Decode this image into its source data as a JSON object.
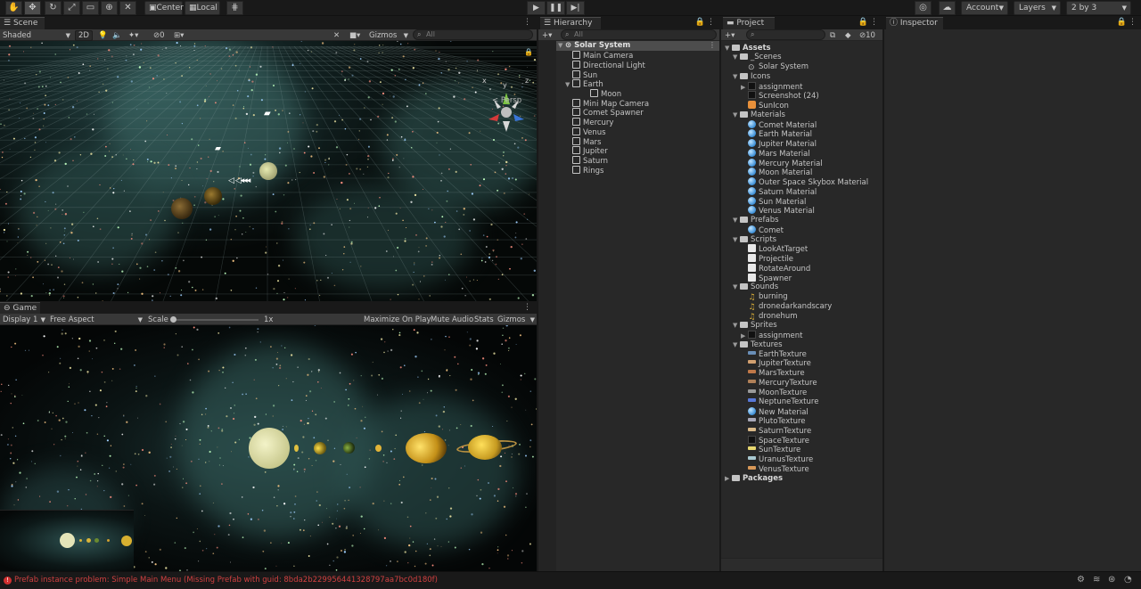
{
  "toolbar": {
    "pivot": "Center",
    "space": "Local",
    "account": "Account",
    "layers": "Layers",
    "layout": "2 by 3"
  },
  "scene": {
    "tab": "Scene",
    "shading": "Shaded",
    "mode_2d": "2D",
    "hidden_count": "0",
    "gizmos": "Gizmos",
    "search_placeholder": "All",
    "persp": "< Persp",
    "axis_x": "x",
    "axis_y": "y",
    "axis_z": "z"
  },
  "game": {
    "tab": "Game",
    "display": "Display 1",
    "aspect": "Free Aspect",
    "scale_label": "Scale",
    "scale_value": "1x",
    "maximize": "Maximize On Play",
    "mute": "Mute Audio",
    "stats": "Stats",
    "gizmos": "Gizmos"
  },
  "hierarchy": {
    "tab": "Hierarchy",
    "search_placeholder": "All",
    "root": "Solar System",
    "items": [
      {
        "label": "Main Camera",
        "depth": 1
      },
      {
        "label": "Directional Light",
        "depth": 1
      },
      {
        "label": "Sun",
        "depth": 1
      },
      {
        "label": "Earth",
        "depth": 1
      },
      {
        "label": "Moon",
        "depth": 2
      },
      {
        "label": "Mini Map Camera",
        "depth": 1
      },
      {
        "label": "Comet Spawner",
        "depth": 1
      },
      {
        "label": "Mercury",
        "depth": 1
      },
      {
        "label": "Venus",
        "depth": 1
      },
      {
        "label": "Mars",
        "depth": 1
      },
      {
        "label": "Jupiter",
        "depth": 1
      },
      {
        "label": "Saturn",
        "depth": 1
      },
      {
        "label": "Rings",
        "depth": 1
      }
    ]
  },
  "project": {
    "tab": "Project",
    "hidden_count": "10",
    "tree": [
      {
        "label": "Assets",
        "depth": 0,
        "kind": "folder",
        "bold": true
      },
      {
        "label": "_Scenes",
        "depth": 1,
        "kind": "folder"
      },
      {
        "label": "Solar System",
        "depth": 2,
        "kind": "scene"
      },
      {
        "label": "Icons",
        "depth": 1,
        "kind": "folder"
      },
      {
        "label": "assignment",
        "depth": 2,
        "kind": "dark",
        "arrow": true
      },
      {
        "label": "Screenshot (24)",
        "depth": 2,
        "kind": "dark"
      },
      {
        "label": "SunIcon",
        "depth": 2,
        "kind": "sunicon"
      },
      {
        "label": "Materials",
        "depth": 1,
        "kind": "folder"
      },
      {
        "label": "Comet Material",
        "depth": 2,
        "kind": "sphere"
      },
      {
        "label": "Earth Material",
        "depth": 2,
        "kind": "sphere"
      },
      {
        "label": "Jupiter Material",
        "depth": 2,
        "kind": "sphere"
      },
      {
        "label": "Mars Material",
        "depth": 2,
        "kind": "sphere"
      },
      {
        "label": "Mercury Material",
        "depth": 2,
        "kind": "sphere"
      },
      {
        "label": "Moon Material",
        "depth": 2,
        "kind": "sphere"
      },
      {
        "label": "Outer Space Skybox Material",
        "depth": 2,
        "kind": "sphere"
      },
      {
        "label": "Saturn Material",
        "depth": 2,
        "kind": "sphere"
      },
      {
        "label": "Sun  Material",
        "depth": 2,
        "kind": "sphere"
      },
      {
        "label": "Venus Material",
        "depth": 2,
        "kind": "sphere"
      },
      {
        "label": "Prefabs",
        "depth": 1,
        "kind": "folder"
      },
      {
        "label": "Comet",
        "depth": 2,
        "kind": "prefab"
      },
      {
        "label": "Scripts",
        "depth": 1,
        "kind": "folder"
      },
      {
        "label": "LookAtTarget",
        "depth": 2,
        "kind": "script"
      },
      {
        "label": "Projectile",
        "depth": 2,
        "kind": "script"
      },
      {
        "label": "RotateAround",
        "depth": 2,
        "kind": "script"
      },
      {
        "label": "Spawner",
        "depth": 2,
        "kind": "script"
      },
      {
        "label": "Sounds",
        "depth": 1,
        "kind": "folder"
      },
      {
        "label": "burning",
        "depth": 2,
        "kind": "audio"
      },
      {
        "label": "dronedarkandscary",
        "depth": 2,
        "kind": "audio"
      },
      {
        "label": "dronehum",
        "depth": 2,
        "kind": "audio"
      },
      {
        "label": "Sprites",
        "depth": 1,
        "kind": "folder"
      },
      {
        "label": "assignment",
        "depth": 2,
        "kind": "dark",
        "arrow": true
      },
      {
        "label": "Textures",
        "depth": 1,
        "kind": "folder"
      },
      {
        "label": "EarthTexture",
        "depth": 2,
        "kind": "tex",
        "color": "#6a8fb8"
      },
      {
        "label": "JupiterTexture",
        "depth": 2,
        "kind": "tex",
        "color": "#d2a070"
      },
      {
        "label": "MarsTexture",
        "depth": 2,
        "kind": "tex",
        "color": "#c07848"
      },
      {
        "label": "MercuryTexture",
        "depth": 2,
        "kind": "tex",
        "color": "#b08058"
      },
      {
        "label": "MoonTexture",
        "depth": 2,
        "kind": "tex",
        "color": "#9a9a9a"
      },
      {
        "label": "NeptuneTexture",
        "depth": 2,
        "kind": "tex",
        "color": "#5878d8"
      },
      {
        "label": "New Material",
        "depth": 2,
        "kind": "sphere"
      },
      {
        "label": "PlutoTexture",
        "depth": 2,
        "kind": "tex",
        "color": "#a8a8b8"
      },
      {
        "label": "SaturnTexture",
        "depth": 2,
        "kind": "tex",
        "color": "#d8b888"
      },
      {
        "label": "SpaceTexture",
        "depth": 2,
        "kind": "dark"
      },
      {
        "label": "SunTexture",
        "depth": 2,
        "kind": "tex",
        "color": "#e8d870"
      },
      {
        "label": "UranusTexture",
        "depth": 2,
        "kind": "tex",
        "color": "#a8c8d0"
      },
      {
        "label": "VenusTexture",
        "depth": 2,
        "kind": "tex",
        "color": "#d89858"
      },
      {
        "label": "Packages",
        "depth": 0,
        "kind": "folder",
        "bold": true,
        "collapsed": true
      }
    ]
  },
  "inspector": {
    "tab": "Inspector"
  },
  "status": {
    "error": "Prefab instance problem: Simple Main Menu (Missing Prefab with guid: 8bda2b229956441328797aa7bc0d180f)"
  },
  "colors": {
    "error": "#d04040",
    "selected_row": "#4d4d4d",
    "panel": "#282828"
  }
}
